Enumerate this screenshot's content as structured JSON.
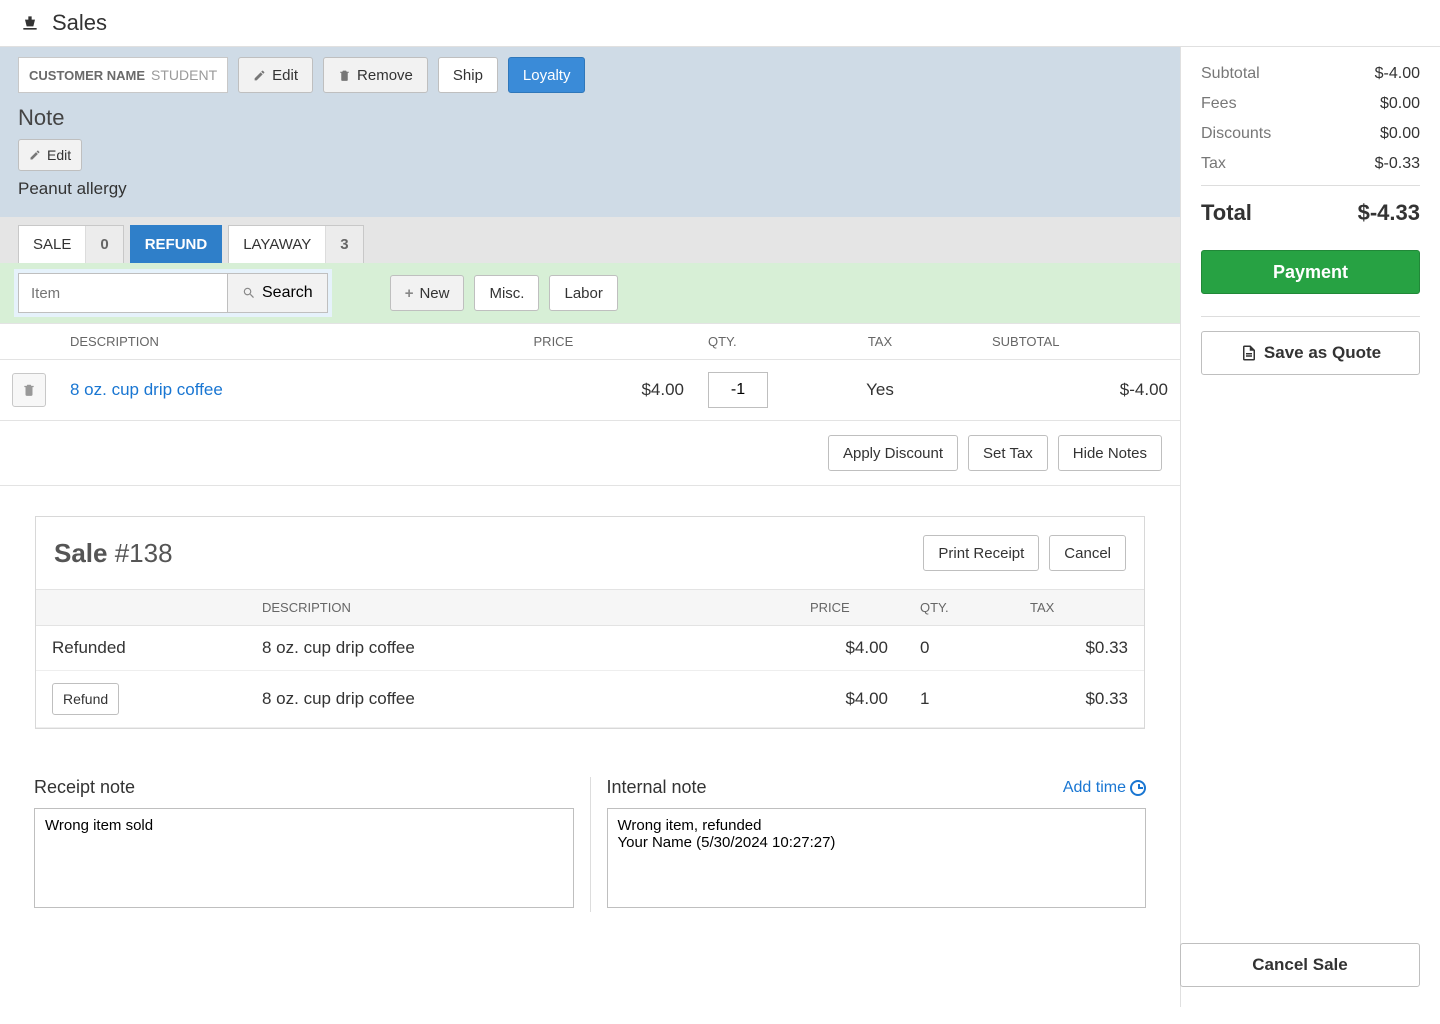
{
  "header": {
    "title": "Sales"
  },
  "customer": {
    "label": "CUSTOMER NAME",
    "value": "STUDENT",
    "edit": "Edit",
    "remove": "Remove",
    "ship": "Ship",
    "loyalty": "Loyalty"
  },
  "note": {
    "heading": "Note",
    "edit": "Edit",
    "text": "Peanut allergy"
  },
  "tabs": {
    "sale": {
      "label": "SALE",
      "count": "0"
    },
    "refund": {
      "label": "REFUND"
    },
    "layaway": {
      "label": "LAYAWAY",
      "count": "3"
    }
  },
  "search": {
    "placeholder": "Item",
    "button": "Search",
    "new": "New",
    "misc": "Misc.",
    "labor": "Labor"
  },
  "lines": {
    "headers": {
      "desc": "DESCRIPTION",
      "price": "PRICE",
      "qty": "QTY.",
      "tax": "TAX",
      "subtotal": "SUBTOTAL"
    },
    "item": {
      "desc": "8 oz. cup drip coffee",
      "price": "$4.00",
      "qty": "-1",
      "tax": "Yes",
      "subtotal": "$-4.00"
    },
    "actions": {
      "discount": "Apply Discount",
      "settax": "Set Tax",
      "hidenotes": "Hide Notes"
    }
  },
  "sale": {
    "title_prefix": "Sale ",
    "title_num": "#138",
    "print": "Print Receipt",
    "cancel": "Cancel",
    "headers": {
      "status": "",
      "desc": "DESCRIPTION",
      "price": "PRICE",
      "qty": "QTY.",
      "tax": "TAX"
    },
    "rows": [
      {
        "status": "Refunded",
        "desc": "8 oz. cup drip coffee",
        "price": "$4.00",
        "qty": "0",
        "tax": "$0.33"
      },
      {
        "status_btn": "Refund",
        "desc": "8 oz. cup drip coffee",
        "price": "$4.00",
        "qty": "1",
        "tax": "$0.33"
      }
    ]
  },
  "receipt_note": {
    "heading": "Receipt note",
    "value": "Wrong item sold"
  },
  "internal_note": {
    "heading": "Internal note",
    "add_time": "Add time",
    "value": "Wrong item, refunded\nYour Name (5/30/2024 10:27:27)"
  },
  "totals": {
    "subtotal_l": "Subtotal",
    "subtotal_v": "$-4.00",
    "fees_l": "Fees",
    "fees_v": "$0.00",
    "discounts_l": "Discounts",
    "discounts_v": "$0.00",
    "tax_l": "Tax",
    "tax_v": "$-0.33",
    "total_l": "Total",
    "total_v": "$-4.33"
  },
  "actions": {
    "payment": "Payment",
    "save_quote": "Save as Quote",
    "cancel_sale": "Cancel Sale"
  }
}
